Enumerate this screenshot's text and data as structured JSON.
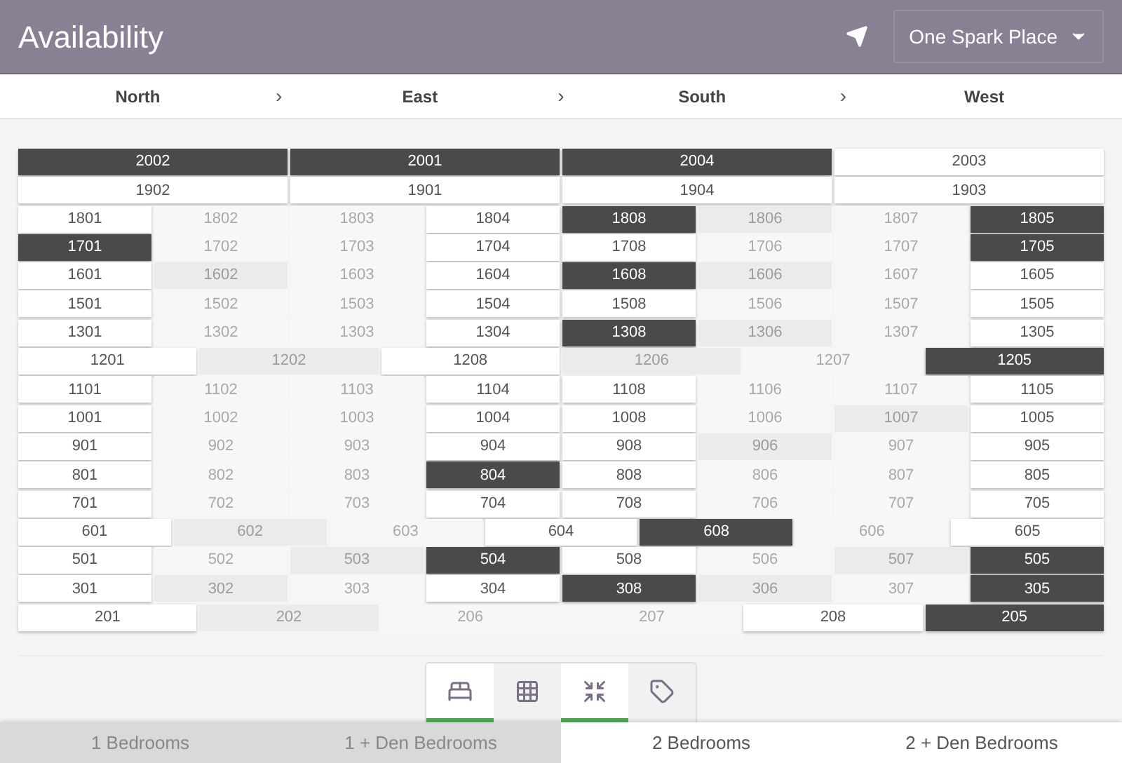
{
  "header": {
    "title": "Availability",
    "building": "One Spark Place"
  },
  "directions": [
    {
      "label": "North",
      "separator": "›"
    },
    {
      "label": "East",
      "separator": "›"
    },
    {
      "label": "South",
      "separator": "›"
    },
    {
      "label": "West"
    }
  ],
  "floors": [
    {
      "units": [
        {
          "label": "2002",
          "kind": "leased"
        },
        {
          "label": "2001",
          "kind": "leased"
        },
        {
          "label": "2004",
          "kind": "leased"
        },
        {
          "label": "2003",
          "kind": "available"
        }
      ]
    },
    {
      "units": [
        {
          "label": "1902",
          "kind": "available"
        },
        {
          "label": "1901",
          "kind": "available"
        },
        {
          "label": "1904",
          "kind": "available"
        },
        {
          "label": "1903",
          "kind": "available"
        }
      ]
    },
    {
      "units": [
        {
          "label": "1801",
          "kind": "available"
        },
        {
          "label": "1802",
          "kind": "filtered"
        },
        {
          "label": "1803",
          "kind": "filtered"
        },
        {
          "label": "1804",
          "kind": "available"
        },
        {
          "label": "1808",
          "kind": "leased"
        },
        {
          "label": "1806",
          "kind": "shaded"
        },
        {
          "label": "1807",
          "kind": "filtered"
        },
        {
          "label": "1805",
          "kind": "leased"
        }
      ]
    },
    {
      "units": [
        {
          "label": "1701",
          "kind": "leased"
        },
        {
          "label": "1702",
          "kind": "filtered"
        },
        {
          "label": "1703",
          "kind": "filtered"
        },
        {
          "label": "1704",
          "kind": "available"
        },
        {
          "label": "1708",
          "kind": "available"
        },
        {
          "label": "1706",
          "kind": "filtered"
        },
        {
          "label": "1707",
          "kind": "filtered"
        },
        {
          "label": "1705",
          "kind": "leased"
        }
      ]
    },
    {
      "units": [
        {
          "label": "1601",
          "kind": "available"
        },
        {
          "label": "1602",
          "kind": "shaded"
        },
        {
          "label": "1603",
          "kind": "filtered"
        },
        {
          "label": "1604",
          "kind": "available"
        },
        {
          "label": "1608",
          "kind": "leased"
        },
        {
          "label": "1606",
          "kind": "shaded"
        },
        {
          "label": "1607",
          "kind": "filtered"
        },
        {
          "label": "1605",
          "kind": "available"
        }
      ]
    },
    {
      "units": [
        {
          "label": "1501",
          "kind": "available"
        },
        {
          "label": "1502",
          "kind": "filtered"
        },
        {
          "label": "1503",
          "kind": "filtered"
        },
        {
          "label": "1504",
          "kind": "available"
        },
        {
          "label": "1508",
          "kind": "available"
        },
        {
          "label": "1506",
          "kind": "filtered"
        },
        {
          "label": "1507",
          "kind": "filtered"
        },
        {
          "label": "1505",
          "kind": "available"
        }
      ]
    },
    {
      "units": [
        {
          "label": "1301",
          "kind": "available"
        },
        {
          "label": "1302",
          "kind": "filtered"
        },
        {
          "label": "1303",
          "kind": "filtered"
        },
        {
          "label": "1304",
          "kind": "available"
        },
        {
          "label": "1308",
          "kind": "leased"
        },
        {
          "label": "1306",
          "kind": "shaded"
        },
        {
          "label": "1307",
          "kind": "filtered"
        },
        {
          "label": "1305",
          "kind": "available"
        }
      ]
    },
    {
      "units": [
        {
          "label": "1201",
          "kind": "available"
        },
        {
          "label": "1202",
          "kind": "shaded"
        },
        {
          "label": "1208",
          "kind": "available"
        },
        {
          "label": "1206",
          "kind": "shaded"
        },
        {
          "label": "1207",
          "kind": "filtered"
        },
        {
          "label": "1205",
          "kind": "leased"
        }
      ]
    },
    {
      "units": [
        {
          "label": "1101",
          "kind": "available"
        },
        {
          "label": "1102",
          "kind": "filtered"
        },
        {
          "label": "1103",
          "kind": "filtered"
        },
        {
          "label": "1104",
          "kind": "available"
        },
        {
          "label": "1108",
          "kind": "available"
        },
        {
          "label": "1106",
          "kind": "filtered"
        },
        {
          "label": "1107",
          "kind": "filtered"
        },
        {
          "label": "1105",
          "kind": "available"
        }
      ]
    },
    {
      "units": [
        {
          "label": "1001",
          "kind": "available"
        },
        {
          "label": "1002",
          "kind": "filtered"
        },
        {
          "label": "1003",
          "kind": "filtered"
        },
        {
          "label": "1004",
          "kind": "available"
        },
        {
          "label": "1008",
          "kind": "available"
        },
        {
          "label": "1006",
          "kind": "filtered"
        },
        {
          "label": "1007",
          "kind": "shaded"
        },
        {
          "label": "1005",
          "kind": "available"
        }
      ]
    },
    {
      "units": [
        {
          "label": "901",
          "kind": "available"
        },
        {
          "label": "902",
          "kind": "filtered"
        },
        {
          "label": "903",
          "kind": "filtered"
        },
        {
          "label": "904",
          "kind": "available"
        },
        {
          "label": "908",
          "kind": "available"
        },
        {
          "label": "906",
          "kind": "shaded"
        },
        {
          "label": "907",
          "kind": "filtered"
        },
        {
          "label": "905",
          "kind": "available"
        }
      ]
    },
    {
      "units": [
        {
          "label": "801",
          "kind": "available"
        },
        {
          "label": "802",
          "kind": "filtered"
        },
        {
          "label": "803",
          "kind": "filtered"
        },
        {
          "label": "804",
          "kind": "leased"
        },
        {
          "label": "808",
          "kind": "available"
        },
        {
          "label": "806",
          "kind": "filtered"
        },
        {
          "label": "807",
          "kind": "filtered"
        },
        {
          "label": "805",
          "kind": "available"
        }
      ]
    },
    {
      "units": [
        {
          "label": "701",
          "kind": "available"
        },
        {
          "label": "702",
          "kind": "filtered"
        },
        {
          "label": "703",
          "kind": "filtered"
        },
        {
          "label": "704",
          "kind": "available"
        },
        {
          "label": "708",
          "kind": "available"
        },
        {
          "label": "706",
          "kind": "filtered"
        },
        {
          "label": "707",
          "kind": "filtered"
        },
        {
          "label": "705",
          "kind": "available"
        }
      ]
    },
    {
      "units": [
        {
          "label": "601",
          "kind": "available"
        },
        {
          "label": "602",
          "kind": "shaded"
        },
        {
          "label": "603",
          "kind": "filtered"
        },
        {
          "label": "604",
          "kind": "available"
        },
        {
          "label": "608",
          "kind": "leased"
        },
        {
          "label": "606",
          "kind": "filtered"
        },
        {
          "label": "605",
          "kind": "available"
        }
      ]
    },
    {
      "units": [
        {
          "label": "501",
          "kind": "available"
        },
        {
          "label": "502",
          "kind": "filtered"
        },
        {
          "label": "503",
          "kind": "shaded"
        },
        {
          "label": "504",
          "kind": "leased"
        },
        {
          "label": "508",
          "kind": "available"
        },
        {
          "label": "506",
          "kind": "filtered"
        },
        {
          "label": "507",
          "kind": "shaded"
        },
        {
          "label": "505",
          "kind": "leased"
        }
      ]
    },
    {
      "units": [
        {
          "label": "301",
          "kind": "available"
        },
        {
          "label": "302",
          "kind": "shaded"
        },
        {
          "label": "303",
          "kind": "filtered"
        },
        {
          "label": "304",
          "kind": "available"
        },
        {
          "label": "308",
          "kind": "leased"
        },
        {
          "label": "306",
          "kind": "shaded"
        },
        {
          "label": "307",
          "kind": "filtered"
        },
        {
          "label": "305",
          "kind": "leased"
        }
      ]
    },
    {
      "units": [
        {
          "label": "201",
          "kind": "available"
        },
        {
          "label": "202",
          "kind": "shaded"
        },
        {
          "label": "206",
          "kind": "filtered"
        },
        {
          "label": "207",
          "kind": "filtered"
        },
        {
          "label": "208",
          "kind": "available"
        },
        {
          "label": "205",
          "kind": "leased"
        }
      ]
    }
  ],
  "view_tabs": [
    {
      "kind": "bed",
      "selected": true
    },
    {
      "kind": "grid",
      "selected": false
    },
    {
      "kind": "shrink",
      "selected": true
    },
    {
      "kind": "tag",
      "selected": false
    }
  ],
  "bedroom_tabs": [
    {
      "label": "1 Bedrooms",
      "selected": false
    },
    {
      "label": "1 + Den Bedrooms",
      "selected": false
    },
    {
      "label": "2 Bedrooms",
      "selected": true
    },
    {
      "label": "2 + Den Bedrooms",
      "selected": true
    }
  ]
}
